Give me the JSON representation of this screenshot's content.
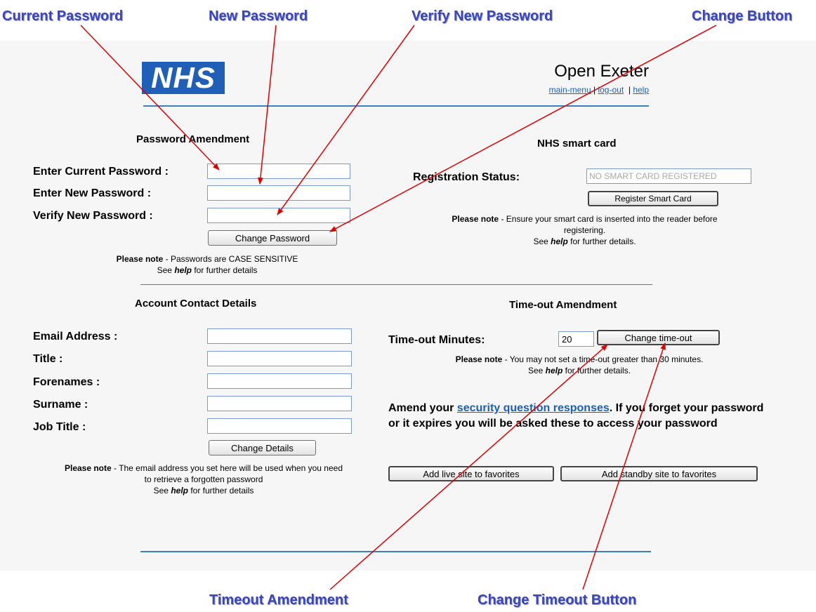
{
  "callouts": {
    "current_password": "Current Password",
    "new_password": "New Password",
    "verify_new_password": "Verify New Password",
    "change_button": "Change Button",
    "timeout_amendment": "Timeout Amendment",
    "change_timeout_button": "Change Timeout Button"
  },
  "header": {
    "logo": "NHS",
    "title": "Open Exeter",
    "links": [
      "main-menu",
      "log-out",
      "help"
    ]
  },
  "password": {
    "heading": "Password Amendment",
    "current_label": "Enter Current Password :",
    "new_label": "Enter New Password :",
    "verify_label": "Verify New Password :",
    "current_value": "",
    "new_value": "",
    "verify_value": "",
    "button": "Change Password",
    "note_bold": "Please note",
    "note_text": " - Passwords are CASE SENSITIVE",
    "note2_pre": "See ",
    "note2_em": "help",
    "note2_post": " for further details"
  },
  "smartcard": {
    "heading": "NHS smart card",
    "status_label": "Registration Status:",
    "status_value": "NO SMART CARD REGISTERED",
    "button": "Register Smart Card",
    "note_bold": "Please note",
    "note_text": " - Ensure your smart card is inserted into the reader before",
    "note_line2": "registering.",
    "note3_pre": "See ",
    "note3_em": "help",
    "note3_post": " for further details."
  },
  "contact": {
    "heading": "Account Contact Details",
    "email_label": "Email Address :",
    "title_label": "Title :",
    "forenames_label": "Forenames :",
    "surname_label": "Surname :",
    "jobtitle_label": "Job Title :",
    "email_value": "",
    "title_value": "",
    "forenames_value": "",
    "surname_value": "",
    "jobtitle_value": "",
    "button": "Change Details",
    "note_bold": "Please note",
    "note_text": " - The email address you set here will be used when you need",
    "note_line2": "to retrieve a forgotten password",
    "note3_pre": "See ",
    "note3_em": "help",
    "note3_post": " for further details"
  },
  "timeout": {
    "heading": "Time-out Amendment",
    "label": "Time-out Minutes:",
    "value": "20",
    "button": "Change time-out",
    "note_bold": "Please note",
    "note_text": " - You may not set a time-out greater than 30 minutes.",
    "note2_pre": "See ",
    "note2_em": "help",
    "note2_post": " for further details."
  },
  "security": {
    "pre": "Amend your ",
    "link": "security question responses",
    "post": ". If you forget your password or it expires you will be asked these to access your password"
  },
  "favorites": {
    "live": "Add live site to favorites",
    "standby": "Add standby site to favorites"
  },
  "colors": {
    "callout": "#3a46b8",
    "nhs_blue": "#1f5fb8",
    "rule": "#3b7fc3",
    "arrow": "#e00000"
  }
}
